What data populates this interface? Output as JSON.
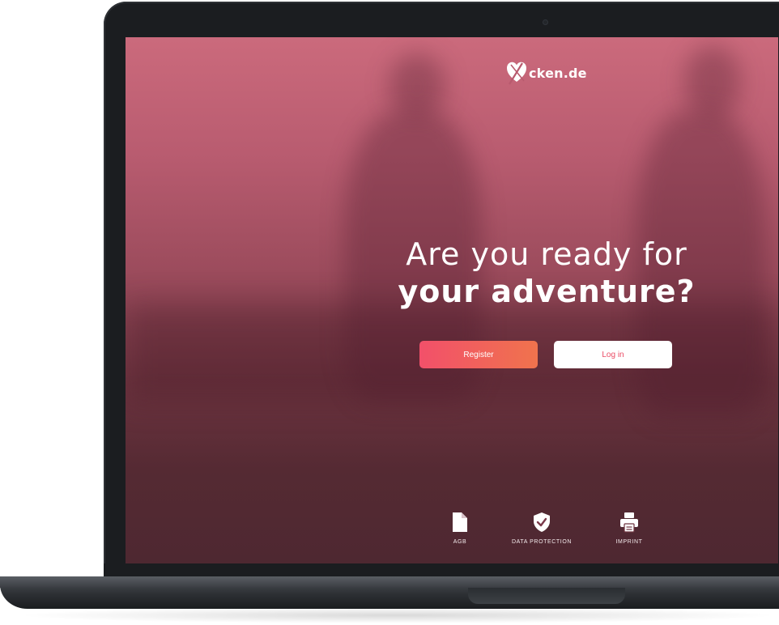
{
  "brand": {
    "logo_text": "cken.de",
    "logo_mark_icon": "heart-x-icon"
  },
  "hero": {
    "headline_line1": "Are you ready for",
    "headline_line2": "your adventure?"
  },
  "buttons": {
    "register_label": "Register",
    "login_label": "Log in"
  },
  "footer": {
    "links": [
      {
        "label": "AGB",
        "icon": "document-icon"
      },
      {
        "label": "DATA PROTECTION",
        "icon": "shield-check-icon"
      },
      {
        "label": "IMPRINT",
        "icon": "printer-icon"
      }
    ]
  },
  "colors": {
    "accent_start": "#f2506a",
    "accent_end": "#f0734d",
    "login_text": "#ea4a63",
    "screen_top": "#cb6a7c",
    "screen_bottom": "#4e2831"
  }
}
